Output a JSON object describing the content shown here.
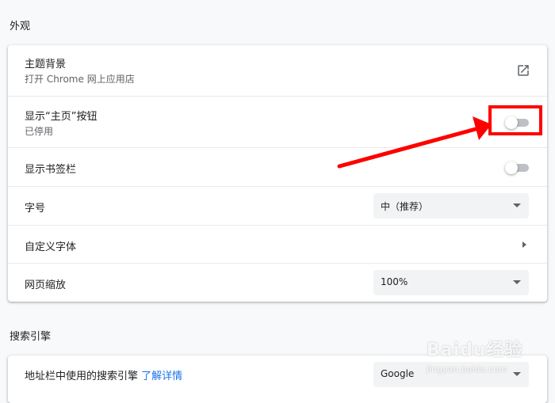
{
  "appearance": {
    "section_title": "外观",
    "theme": {
      "label": "主题背景",
      "sub": "打开 Chrome 网上应用店",
      "icon": "open-in-new-icon"
    },
    "home_button": {
      "label": "显示“主页”按钮",
      "sub": "已停用",
      "enabled": false
    },
    "bookmarks_bar": {
      "label": "显示书签栏",
      "enabled": false
    },
    "font_size": {
      "label": "字号",
      "value": "中（推荐）"
    },
    "custom_fonts": {
      "label": "自定义字体"
    },
    "page_zoom": {
      "label": "网页缩放",
      "value": "100%"
    }
  },
  "search_engine": {
    "section_title": "搜索引擎",
    "address_bar": {
      "label": "地址栏中使用的搜索引擎",
      "link": "了解详情",
      "value": "Google"
    }
  },
  "annotation": {
    "color": "#ff0000"
  },
  "watermark": {
    "text": "Baidu经验",
    "sub": "jingyan.baidu.com"
  }
}
